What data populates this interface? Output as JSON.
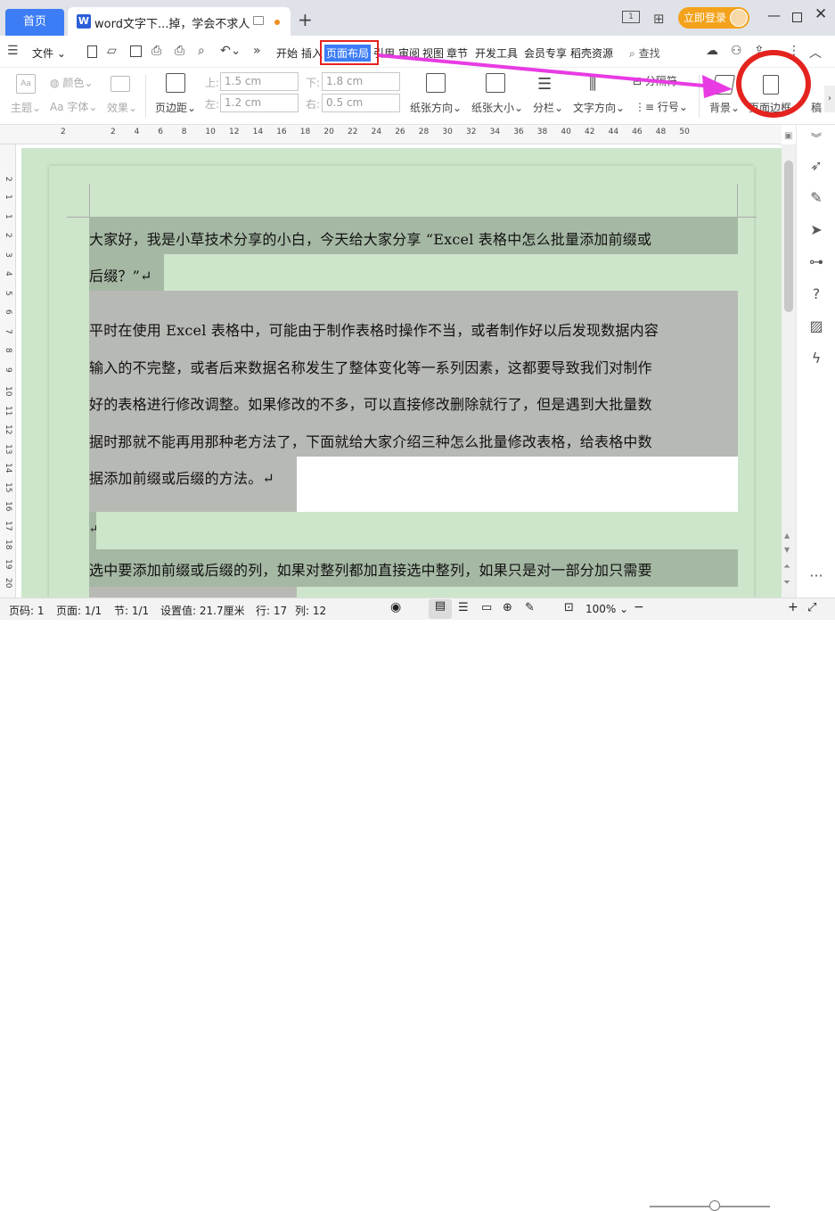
{
  "titlebar": {
    "home_tab": "首页",
    "doc_tab": "word文字下...掉，学会不求人",
    "new_tab": "+",
    "login": "立即登录"
  },
  "menu": {
    "file": "文件",
    "items": [
      "开始",
      "插入",
      "页面布局",
      "引用",
      "审阅",
      "视图",
      "章节",
      "开发工具",
      "会员专享",
      "稻壳资源"
    ],
    "active": "页面布局",
    "search": "查找"
  },
  "ribbon": {
    "theme": "主题",
    "color": "颜色",
    "font": "Aa 字体",
    "effect": "效果",
    "margin": "页边距",
    "top_label": "上:",
    "top_val": "1.5 cm",
    "bottom_label": "下:",
    "bottom_val": "1.8 cm",
    "left_label": "左:",
    "left_val": "1.2 cm",
    "right_label": "右:",
    "right_val": "0.5 cm",
    "orientation": "纸张方向",
    "size": "纸张大小",
    "columns": "分栏",
    "text_dir": "文字方向",
    "line_num": "行号",
    "separator": "分隔符",
    "background": "背景",
    "page_border": "页面边框",
    "draft": "稿"
  },
  "ruler": {
    "h": [
      "2",
      "2",
      "4",
      "6",
      "8",
      "10",
      "12",
      "14",
      "16",
      "18",
      "20",
      "22",
      "24",
      "26",
      "28",
      "30",
      "32",
      "34",
      "36",
      "38",
      "40",
      "42",
      "44",
      "46",
      "48",
      "50"
    ],
    "v": [
      "2",
      "1",
      "1",
      "2",
      "3",
      "4",
      "5",
      "6",
      "7",
      "8",
      "9",
      "10",
      "11",
      "12",
      "13",
      "14",
      "15",
      "16",
      "17",
      "18",
      "19",
      "20"
    ]
  },
  "document": {
    "lines": [
      "大家好，我是小草技术分享的小白，今天给大家分享 “Excel 表格中怎么批量添加前缀或",
      "后缀？”↵",
      "平时在使用 Excel 表格中，可能由于制作表格时操作不当，或者制作好以后发现数据内容",
      "输入的不完整，或者后来数据名称发生了整体变化等一系列因素，这都要导致我们对制作",
      "好的表格进行修改调整。如果修改的不多，可以直接修改删除就行了，但是遇到大批量数",
      "据时那就不能再用那种老方法了，下面就给大家介绍三种怎么批量修改表格，给表格中数",
      "据添加前缀或后缀的方法。↵",
      "↵",
      "选中要添加前缀或后缀的列，如果对整列都加直接选中整列，如果只是对一部分加只需要"
    ]
  },
  "status": {
    "page_no": "页码: 1",
    "pages": "页面: 1/1",
    "section": "节: 1/1",
    "setting": "设置值: 21.7厘米",
    "row": "行: 17",
    "col": "列: 12",
    "zoom": "100%"
  }
}
